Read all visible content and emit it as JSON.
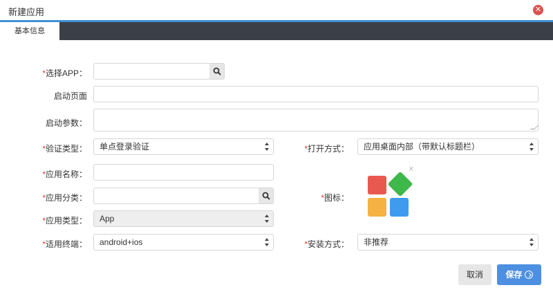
{
  "dialog": {
    "title": "新建应用"
  },
  "tabs": [
    {
      "label": "基本信息"
    }
  ],
  "form": {
    "select_app": {
      "label": "选择APP："
    },
    "start_page": {
      "label": "启动页面"
    },
    "start_params": {
      "label": "启动参数："
    },
    "auth_type": {
      "label": "验证类型：",
      "value": "单点登录验证"
    },
    "open_mode": {
      "label": "打开方式：",
      "value": "应用桌面内部（带默认标题栏）"
    },
    "app_name": {
      "label": "应用名称："
    },
    "app_category": {
      "label": "应用分类："
    },
    "icon": {
      "label": "图标："
    },
    "app_type": {
      "label": "应用类型：",
      "value": "App"
    },
    "terminal": {
      "label": "适用终端：",
      "value": "android+ios"
    },
    "install_mode": {
      "label": "安装方式：",
      "value": "非推荐"
    }
  },
  "buttons": {
    "cancel": "取消",
    "save": "保存"
  },
  "icons": {
    "close": "close-circle-icon",
    "search": "search-icon",
    "remove": "remove-x-icon"
  },
  "colors": {
    "accent": "#3f8fd8",
    "tabbar": "#3b4048",
    "required": "#e03a3a",
    "tile_red": "#e8584f",
    "tile_green": "#3eb84a",
    "tile_yellow": "#f5b142",
    "tile_blue": "#3e9bee"
  }
}
